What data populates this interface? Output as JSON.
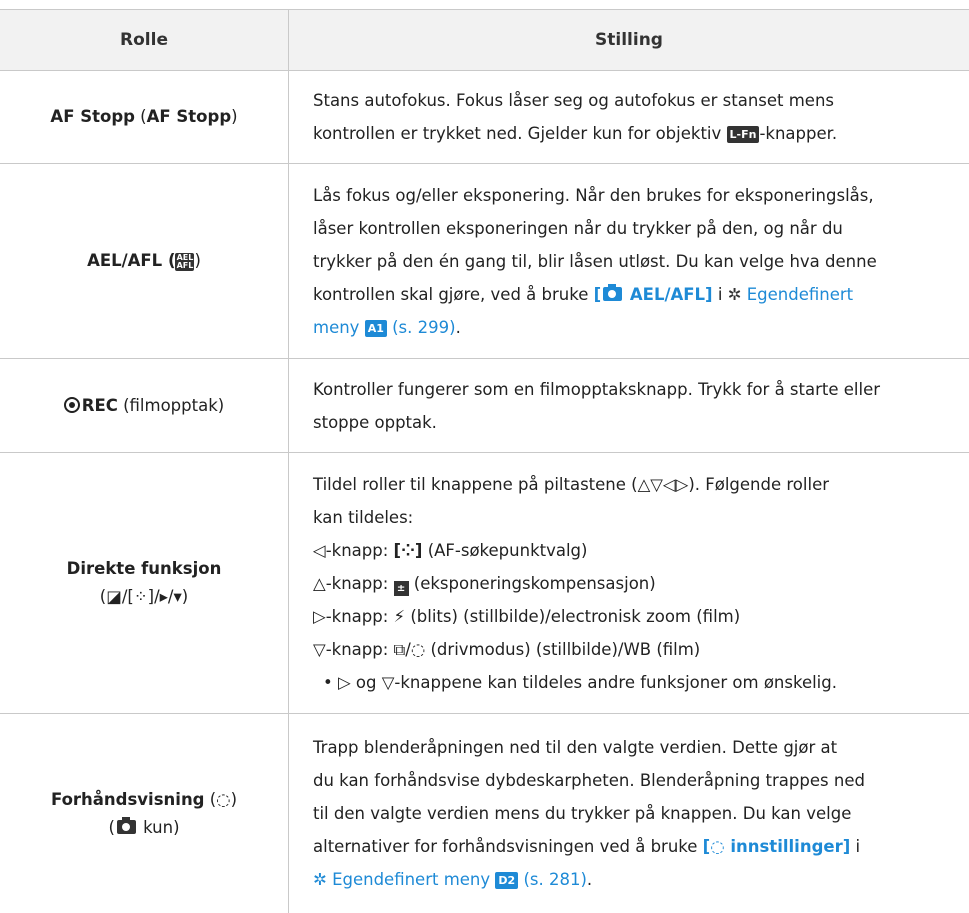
{
  "header": {
    "col_role": "Rolle",
    "col_setting": "Stilling"
  },
  "rows": [
    {
      "role_a": "AF Stopp",
      "role_paren_open": " (",
      "role_b": "AF Stopp",
      "role_paren_close": ")",
      "line1": "Stans autofokus. Fokus låser seg og autofokus er stanset mens",
      "line2_a": "kontrollen er trykket ned. Gjelder kun for objektiv ",
      "badge": "L-Fn",
      "line2_b": "-knapper."
    },
    {
      "role": "AEL/AFL (",
      "role_close": ")",
      "ael_icon": "AEL AFL",
      "line1": "Lås fokus og/eller eksponering. Når den brukes for eksponeringslås,",
      "line2": "låser kontrollen eksponeringen når du trykker på den, og når du",
      "line3": "trykker på den én gang til, blir låsen utløst. Du kan velge hva denne",
      "line4_a": "kontrollen skal gjøre, ved å bruke ",
      "link1_open": "[",
      "link1_text": " AEL/AFL]",
      "line4_b": " i ",
      "gear": "✲",
      "link2": " Egendefinert",
      "line5_link": "meny ",
      "badge": "A1",
      "line5_ref": " (s. 299)",
      "line5_end": "."
    },
    {
      "role_b": "REC",
      "role_rest": " (filmopptak)",
      "line1": "Kontroller fungerer som en filmopptaksknapp. Trykk for å starte eller",
      "line2": "stoppe opptak."
    },
    {
      "role": "Direkte funksjon",
      "role_sub": "(◪/[⁘]/▸/▾)",
      "line1": "Tildel roller til knappene på piltastene (△▽◁▷). Følgende roller",
      "line2": "kan tildeles:",
      "line3_a": "◁-knapp: ",
      "line3_b": "[⁘]",
      "line3_c": " (AF-søkepunktvalg)",
      "line4_a": "△-knapp: ",
      "line4_icon": "±",
      "line4_c": " (eksponeringskompensasjon)",
      "line5": "▷-knapp: ⚡ (blits) (stillbilde)/electronisk zoom (film)",
      "line6": "▽-knapp: ⧉/◌ (drivmodus) (stillbilde)/WB (film)",
      "line7": "• ▷ og ▽-knappene kan tildeles andre funksjoner om ønskelig."
    },
    {
      "role_a": "Forhåndsvisning",
      "role_b": " (◌)",
      "role_sub_a": "(",
      "role_sub_b": " kun)",
      "line1": "Trapp blenderåpningen ned til den valgte verdien. Dette gjør at",
      "line2": "du kan forhåndsvise dybdeskarpheten. Blenderåpning trappes ned",
      "line3": "til den valgte verdien mens du trykker på knappen. Du kan velge",
      "line4_a": "alternativer for forhåndsvisningen ved å bruke ",
      "link1": "[◌ innstillinger]",
      "line4_b": " i",
      "gear": "✲",
      "link2": " Egendefinert meny ",
      "badge": "D2",
      "ref": " (s. 281)",
      "end": "."
    }
  ]
}
